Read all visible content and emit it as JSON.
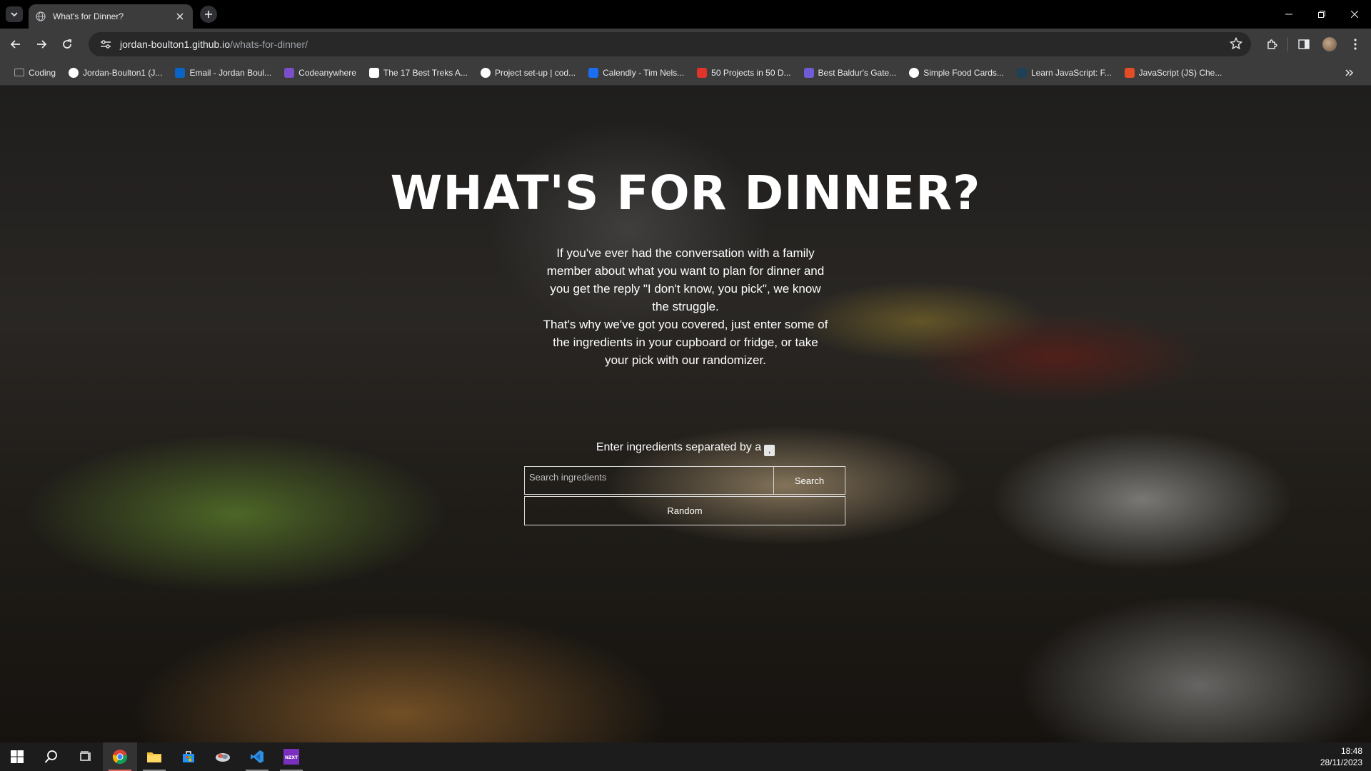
{
  "browser": {
    "tab_title": "What's for Dinner?",
    "url_host": "jordan-boulton1.github.io",
    "url_path": "/whats-for-dinner/",
    "bookmarks": [
      {
        "label": "Coding",
        "icon": "folder-icon",
        "color": "#9aa0a6"
      },
      {
        "label": "Jordan-Boulton1 (J...",
        "icon": "github-icon",
        "color": "#ffffff"
      },
      {
        "label": "Email - Jordan Boul...",
        "icon": "outlook-icon",
        "color": "#0a64c8"
      },
      {
        "label": "Codeanywhere",
        "icon": "codeanywhere-icon",
        "color": "#7b4fc9"
      },
      {
        "label": "The 17 Best Treks A...",
        "icon": "page-icon",
        "color": "#ffffff"
      },
      {
        "label": "Project set-up | cod...",
        "icon": "globe-icon",
        "color": "#ffffff"
      },
      {
        "label": "Calendly - Tim Nels...",
        "icon": "calendly-icon",
        "color": "#1a6ff0"
      },
      {
        "label": "50 Projects in 50 D...",
        "icon": "udemy-icon",
        "color": "#e0342a"
      },
      {
        "label": "Best Baldur's Gate...",
        "icon": "bookmark-icon",
        "color": "#6e5bd6"
      },
      {
        "label": "Simple Food Cards...",
        "icon": "codepen-icon",
        "color": "#ffffff"
      },
      {
        "label": "Learn JavaScript: F...",
        "icon": "codecademy-icon",
        "color": "#1f4056"
      },
      {
        "label": "JavaScript (JS) Che...",
        "icon": "html-icon",
        "color": "#e44d26"
      }
    ]
  },
  "page": {
    "title": "WHAT'S FOR DINNER?",
    "intro_paragraph_1": "If you've ever had the conversation with a family member about what you want to plan for dinner and you get the reply \"I don't know, you pick\", we know the struggle.",
    "intro_paragraph_2": "That's why we've got you covered, just enter some of the ingredients in your cupboard or fridge, or take your pick with our randomizer.",
    "ingredients_label": "Enter ingredients separated by a",
    "comma_key": ",",
    "search_placeholder": "Search ingredients",
    "search_button": "Search",
    "random_button": "Random"
  },
  "taskbar": {
    "time": "18:48",
    "date": "28/11/2023",
    "apps": [
      "start-icon",
      "search-icon",
      "task-view-icon",
      "chrome-icon",
      "file-explorer-icon",
      "store-icon",
      "cloud-app-icon",
      "vscode-icon",
      "nzxt-icon"
    ],
    "accent_color": "#e06a5a"
  }
}
